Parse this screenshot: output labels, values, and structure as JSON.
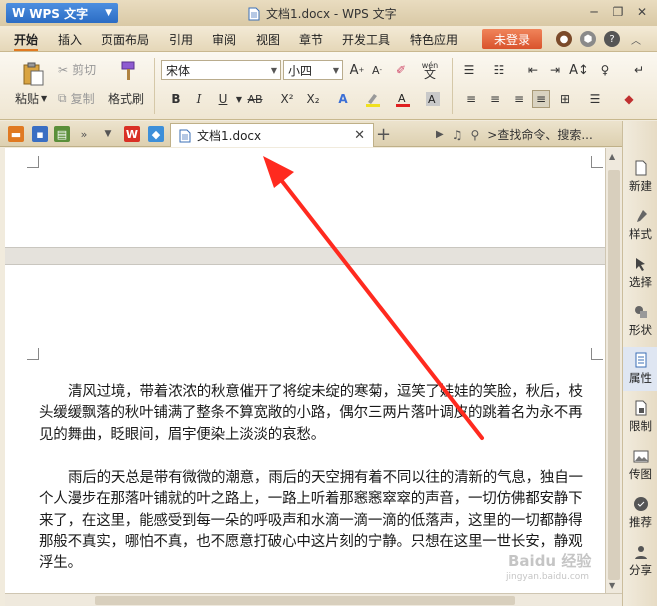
{
  "titlebar": {
    "app_name": "WPS 文字",
    "window_title": "文档1.docx - WPS 文字"
  },
  "menu": {
    "items": [
      "开始",
      "插入",
      "页面布局",
      "引用",
      "审阅",
      "视图",
      "章节",
      "开发工具",
      "特色应用"
    ],
    "active_index": 0,
    "login_label": "未登录"
  },
  "ribbon": {
    "paste_label": "粘贴",
    "cut_label": "剪切",
    "copy_label": "复制",
    "format_painter_label": "格式刷",
    "font_name": "宋体",
    "font_size": "小四",
    "wen_label": "wén",
    "wen_char": "文",
    "buttons_row2": [
      "B",
      "I",
      "U",
      "AB",
      "X²",
      "X₂"
    ]
  },
  "tabbar": {
    "doc_tab_label": "文档1.docx",
    "search_placeholder": ">查找命令、搜索..."
  },
  "document": {
    "paragraphs": [
      "清风过境，带着浓浓的秋意催开了将绽未绽的寒菊，逗笑了娃娃的笑脸，秋后，枝头缓缓飘落的秋叶铺满了整条不算宽敞的小路，偶尔三两片落叶调皮的跳着名为永不再见的舞曲，眨眼间，眉宇便染上淡淡的哀愁。",
      "雨后的天总是带有微微的潮意，雨后的天空拥有着不同以往的清新的气息，独自一个人漫步在那落叶铺就的叶之路上，一路上听着那窸窸窣窣的声音，一切仿佛都安静下来了，在这里，能感受到每一朵的呼吸声和水滴一滴一滴的低落声，这里的一切都静得那般不真实，哪怕不真，也不愿意打破心中这片刻的宁静。只想在这里一世长安，静观浮生。"
    ]
  },
  "sidepane": {
    "items": [
      "新建",
      "样式",
      "选择",
      "形状",
      "属性",
      "限制",
      "传图",
      "推荐",
      "分享"
    ]
  },
  "watermark": {
    "text": "Baidu 经验",
    "url": "jingyan.baidu.com"
  },
  "colors": {
    "accent": "#e27a22",
    "annotation_arrow": "#ff2a1f",
    "app_button": "#2b6cc4",
    "login_button": "#d9532c"
  }
}
